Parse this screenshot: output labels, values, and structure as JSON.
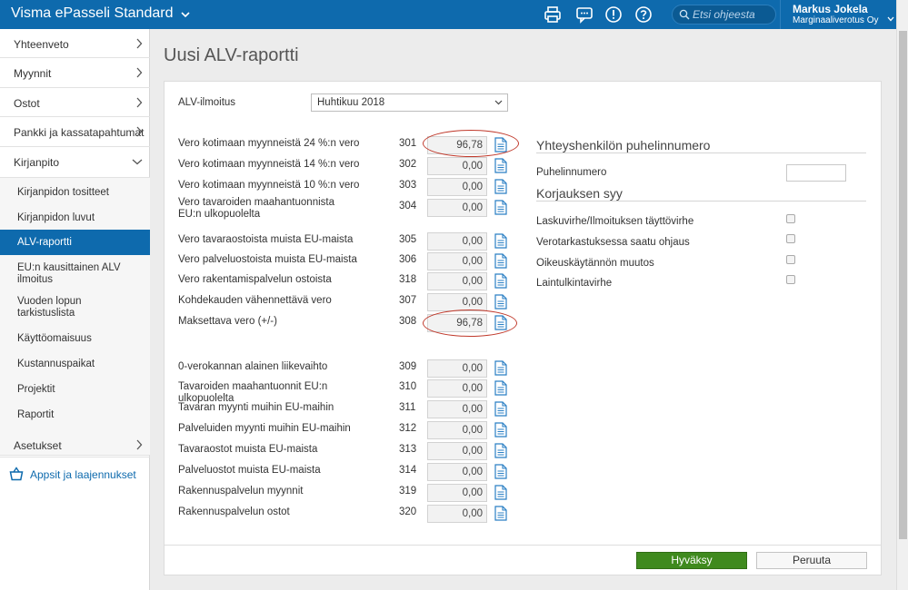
{
  "app": {
    "title": "Visma ePasseli Standard"
  },
  "header": {
    "search_placeholder": "Etsi ohjeesta",
    "user_name": "Markus Jokela",
    "user_company": "Marginaaliverotus Oy"
  },
  "sidebar": {
    "items": [
      {
        "label": "Yhteenveto"
      },
      {
        "label": "Myynnit"
      },
      {
        "label": "Ostot"
      },
      {
        "label": "Pankki ja kassatapahtumat"
      },
      {
        "label": "Kirjanpito"
      }
    ],
    "subitems": [
      {
        "label": "Kirjanpidon tositteet"
      },
      {
        "label": "Kirjanpidon luvut"
      },
      {
        "label": "ALV-raportti"
      },
      {
        "label": "EU:n kausittainen ALV ilmoitus"
      },
      {
        "label": "Vuoden lopun tarkistuslista"
      },
      {
        "label": "Käyttöomaisuus"
      },
      {
        "label": "Kustannuspaikat"
      },
      {
        "label": "Projektit"
      },
      {
        "label": "Raportit"
      }
    ],
    "settings": "Asetukset",
    "apps_link": "Appsit ja laajennukset"
  },
  "page": {
    "title": "Uusi ALV-raportti"
  },
  "form": {
    "period_label": "ALV-ilmoitus",
    "period_value": "Huhtikuu 2018",
    "rows": [
      {
        "label": "Vero kotimaan myynneistä 24 %:n vero",
        "code": "301",
        "value": "96,78"
      },
      {
        "label": "Vero kotimaan myynneistä 14 %:n vero",
        "code": "302",
        "value": "0,00"
      },
      {
        "label": "Vero kotimaan myynneistä 10 %:n vero",
        "code": "303",
        "value": "0,00"
      },
      {
        "label": "Vero tavaroiden maahantuonnista EU:n ulkopuolelta",
        "code": "304",
        "value": "0,00"
      },
      {
        "label": "Vero tavaraostoista muista EU-maista",
        "code": "305",
        "value": "0,00"
      },
      {
        "label": "Vero palveluostoista muista EU-maista",
        "code": "306",
        "value": "0,00"
      },
      {
        "label": "Vero rakentamispalvelun ostoista",
        "code": "318",
        "value": "0,00"
      },
      {
        "label": "Kohdekauden vähennettävä vero",
        "code": "307",
        "value": "0,00"
      },
      {
        "label": "Maksettava vero (+/-)",
        "code": "308",
        "value": "96,78"
      },
      {
        "label": "0-verokannan alainen liikevaihto",
        "code": "309",
        "value": "0,00"
      },
      {
        "label": "Tavaroiden maahantuonnit EU:n ulkopuolelta",
        "code": "310",
        "value": "0,00"
      },
      {
        "label": "Tavaran myynti muihin EU-maihin",
        "code": "311",
        "value": "0,00"
      },
      {
        "label": "Palveluiden myynti muihin EU-maihin",
        "code": "312",
        "value": "0,00"
      },
      {
        "label": "Tavaraostot muista EU-maista",
        "code": "313",
        "value": "0,00"
      },
      {
        "label": "Palveluostot muista EU-maista",
        "code": "314",
        "value": "0,00"
      },
      {
        "label": "Rakennuspalvelun myynnit",
        "code": "319",
        "value": "0,00"
      },
      {
        "label": "Rakennuspalvelun ostot",
        "code": "320",
        "value": "0,00"
      }
    ]
  },
  "contact": {
    "title": "Yhteyshenkilön puhelinnumero",
    "phone_label": "Puhelinnumero",
    "phone_value": ""
  },
  "corrections": {
    "title": "Korjauksen syy",
    "options": [
      {
        "label": "Laskuvirhe/Ilmoituksen täyttövirhe"
      },
      {
        "label": "Verotarkastuksessa saatu ohjaus"
      },
      {
        "label": "Oikeuskäytännön muutos"
      },
      {
        "label": "Laintulkintavirhe"
      }
    ]
  },
  "buttons": {
    "ok": "Hyväksy",
    "cancel": "Peruuta"
  },
  "colors": {
    "brand": "#0e6aad",
    "ok_button": "#3f8a1e",
    "highlight": "#c0392b"
  }
}
